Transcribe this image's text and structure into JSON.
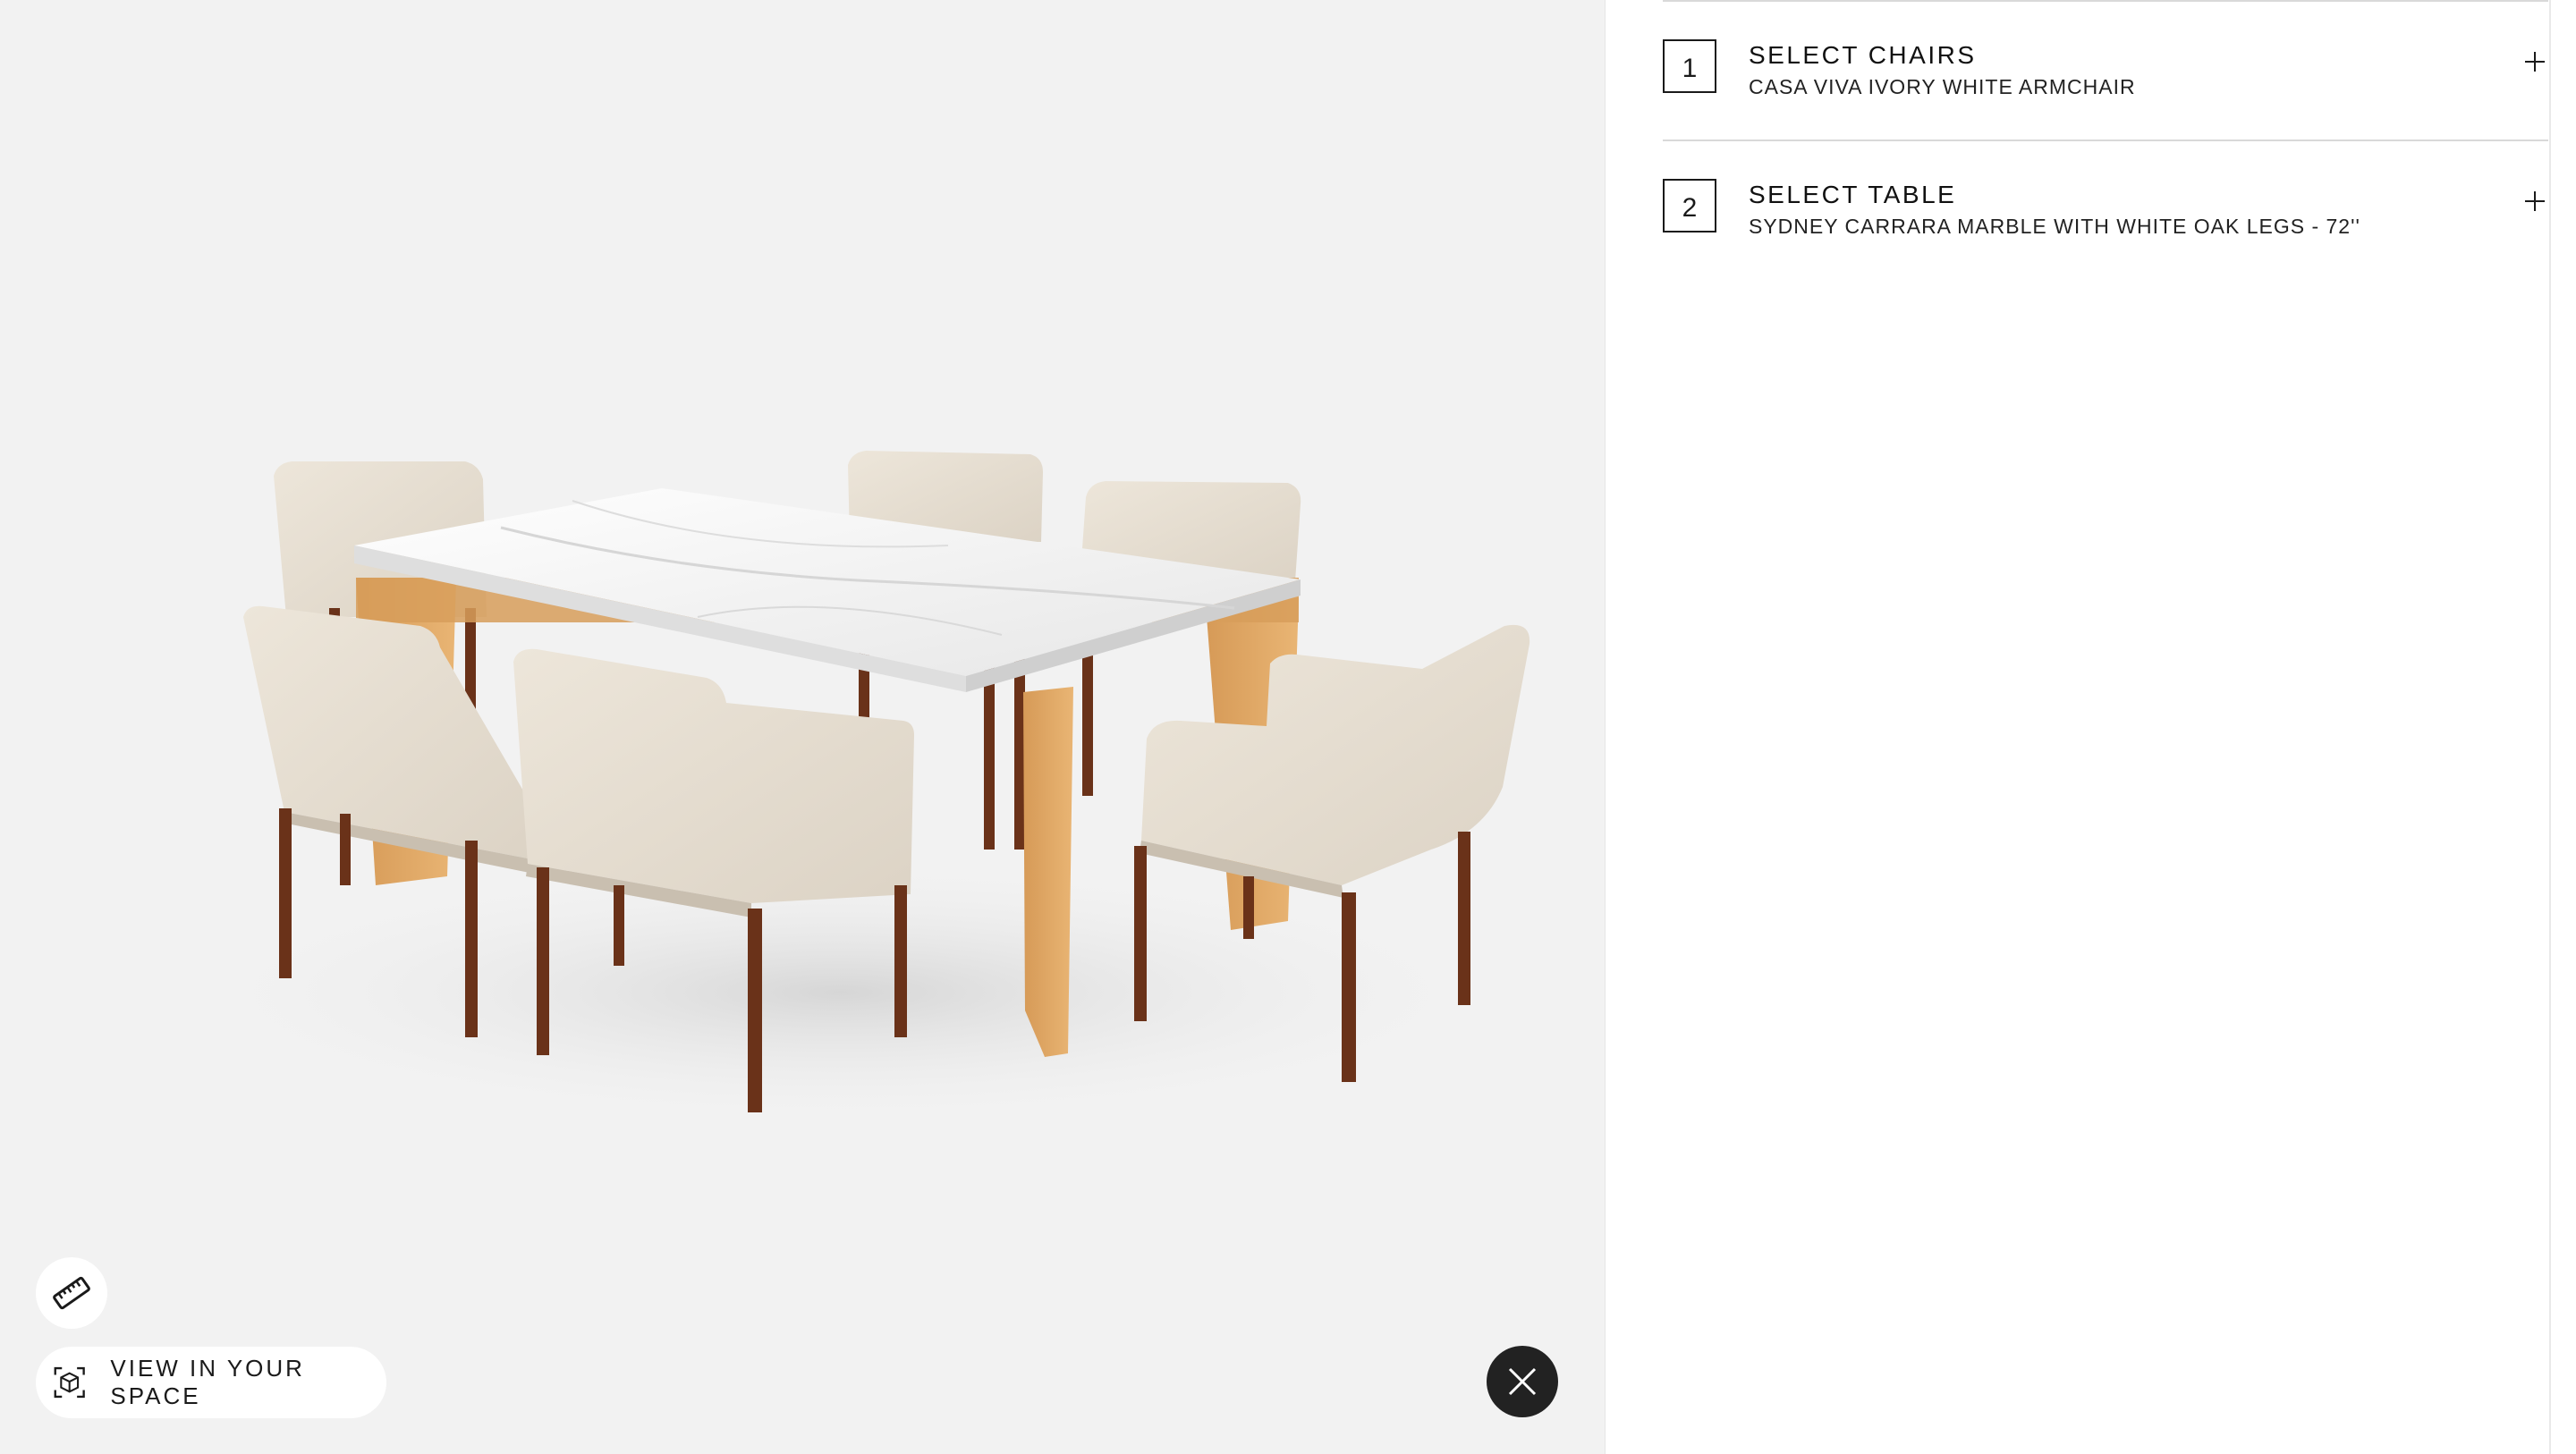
{
  "viewer": {
    "background": "#f2f2f2",
    "measure_icon": "ruler-icon",
    "view_in_space_icon": "ar-cube-icon",
    "view_in_space_label": "VIEW IN YOUR SPACE",
    "close_icon": "close-icon"
  },
  "configurator": {
    "steps": [
      {
        "number": "1",
        "title": "SELECT CHAIRS",
        "selection": "CASA VIVA IVORY WHITE ARMCHAIR",
        "icon": "plus-icon"
      },
      {
        "number": "2",
        "title": "SELECT TABLE",
        "selection": "SYDNEY CARRARA MARBLE WITH WHITE OAK LEGS - 72''",
        "icon": "plus-icon"
      }
    ]
  }
}
